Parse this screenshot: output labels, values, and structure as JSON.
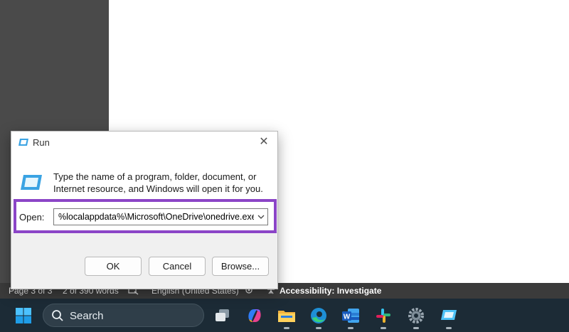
{
  "statusbar": {
    "page": "Page 3 of 3",
    "words": "2 of 390 words",
    "language": "English (United States)",
    "accessibility": "Accessibility: Investigate"
  },
  "taskbar": {
    "search_label": "Search",
    "icons": [
      "windows-start-icon",
      "search-icon",
      "task-view-icon",
      "copilot-icon",
      "file-explorer-icon",
      "edge-icon",
      "word-icon",
      "slack-icon",
      "settings-icon",
      "run-icon"
    ]
  },
  "dialog": {
    "title": "Run",
    "description": "Type the name of a program, folder, document, or Internet resource, and Windows will open it for you.",
    "open_label": "Open:",
    "open_value": "%localappdata%\\Microsoft\\OneDrive\\onedrive.exe",
    "buttons": {
      "ok": "OK",
      "cancel": "Cancel",
      "browse": "Browse..."
    }
  },
  "colors": {
    "highlight": "#8b45c7",
    "taskbar": "#1c2b36",
    "statusbar": "#3b3b3b"
  }
}
